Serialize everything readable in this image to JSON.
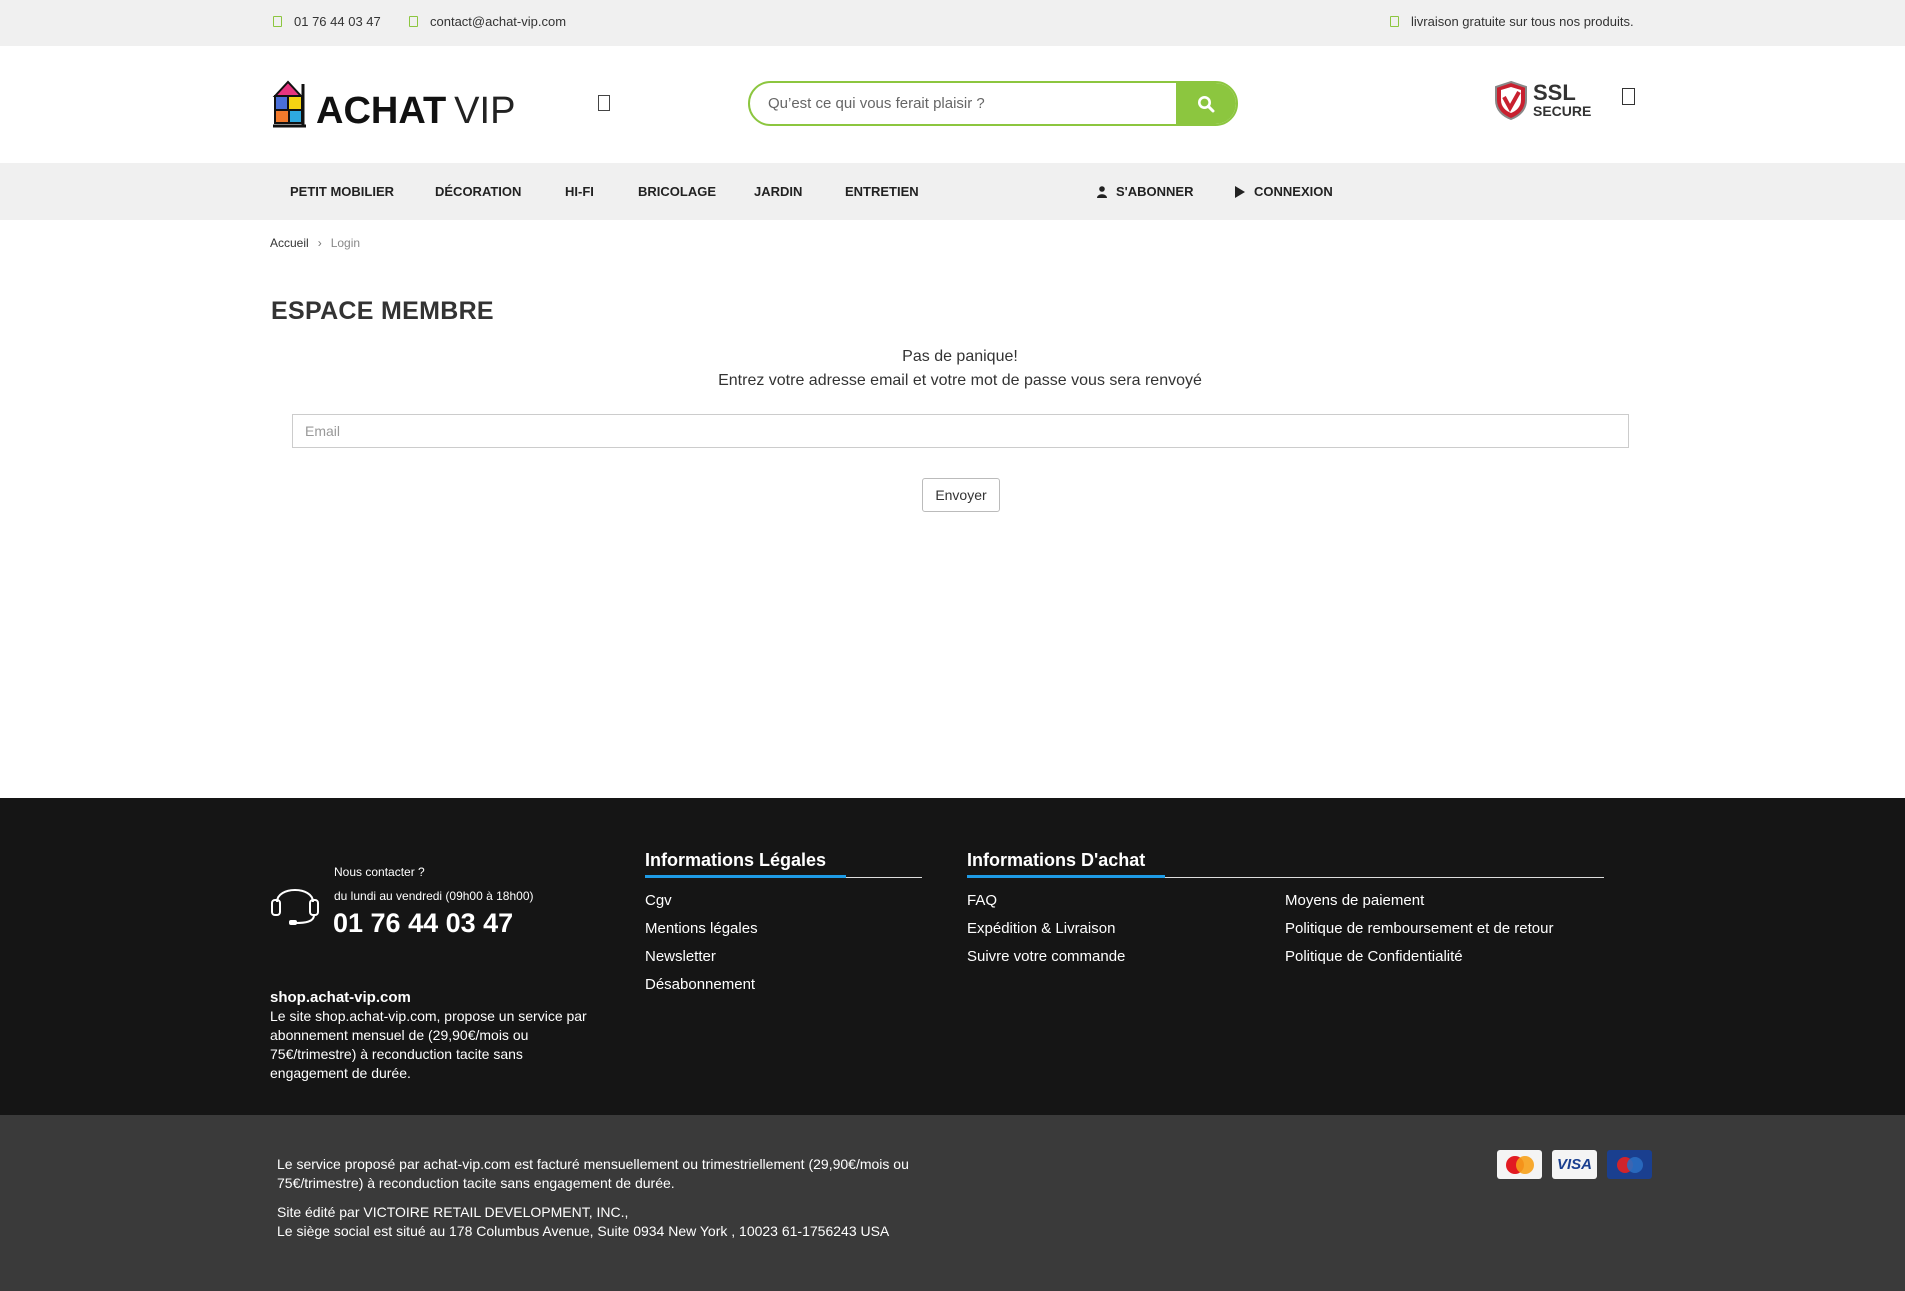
{
  "topbar": {
    "phone": "01 76 44 03 47",
    "email": "contact@achat-vip.com",
    "shipping": "livraison gratuite sur tous nos produits."
  },
  "header": {
    "logo_main": "ACHAT",
    "logo_vip": "VIP",
    "search_placeholder": "Qu’est ce qui vous ferait plaisir ?",
    "ssl_big": "SSL",
    "ssl_small": "SECURE",
    "accent_color": "#8cc63f"
  },
  "nav": {
    "items": [
      "PETIT MOBILIER",
      "DÉCORATION",
      "HI-FI",
      "BRICOLAGE",
      "JARDIN",
      "ENTRETIEN"
    ],
    "subscribe": "S'ABONNER",
    "login": "CONNEXION"
  },
  "breadcrumb": {
    "home": "Accueil",
    "current": "Login"
  },
  "main": {
    "title": "ESPACE MEMBRE",
    "line1": "Pas de panique!",
    "line2": "Entrez votre adresse email et votre mot de passe vous sera renvoyé",
    "email_placeholder": "Email",
    "submit": "Envoyer"
  },
  "footer": {
    "contact_label": "Nous contacter ?",
    "contact_hours": "du lundi au vendredi (09h00 à 18h00)",
    "contact_phone": "01 76 44 03 47",
    "site_name": "shop.achat-vip.com",
    "site_desc": "Le site shop.achat-vip.com, propose un service par abonnement mensuel de (29,90€/mois ou 75€/trimestre) à reconduction tacite sans engagement de durée.",
    "legal_title": "Informations Légales",
    "legal_links": [
      "Cgv",
      "Mentions légales",
      "Newsletter",
      "Désabonnement"
    ],
    "purchase_title": "Informations D'achat",
    "purchase_links_col1": [
      "FAQ",
      "Expédition & Livraison",
      "Suivre votre commande"
    ],
    "purchase_links_col2": [
      "Moyens de paiement",
      "Politique de remboursement et de retour",
      "Politique de Confidentialité"
    ],
    "accent_color": "#1e9be5"
  },
  "bottom": {
    "line1": "Le service proposé par achat-vip.com est facturé mensuellement ou trimestriellement (29,90€/mois ou",
    "line2": "75€/trimestre) à reconduction tacite sans engagement de durée.",
    "line3": "Site édité par VICTOIRE RETAIL DEVELOPMENT, INC.,",
    "line4": "Le siège social est situé au 178 Columbus Avenue, Suite 0934 New York , 10023 61-1756243 USA",
    "cards": [
      "MasterCard",
      "VISA",
      "Maestro"
    ]
  }
}
